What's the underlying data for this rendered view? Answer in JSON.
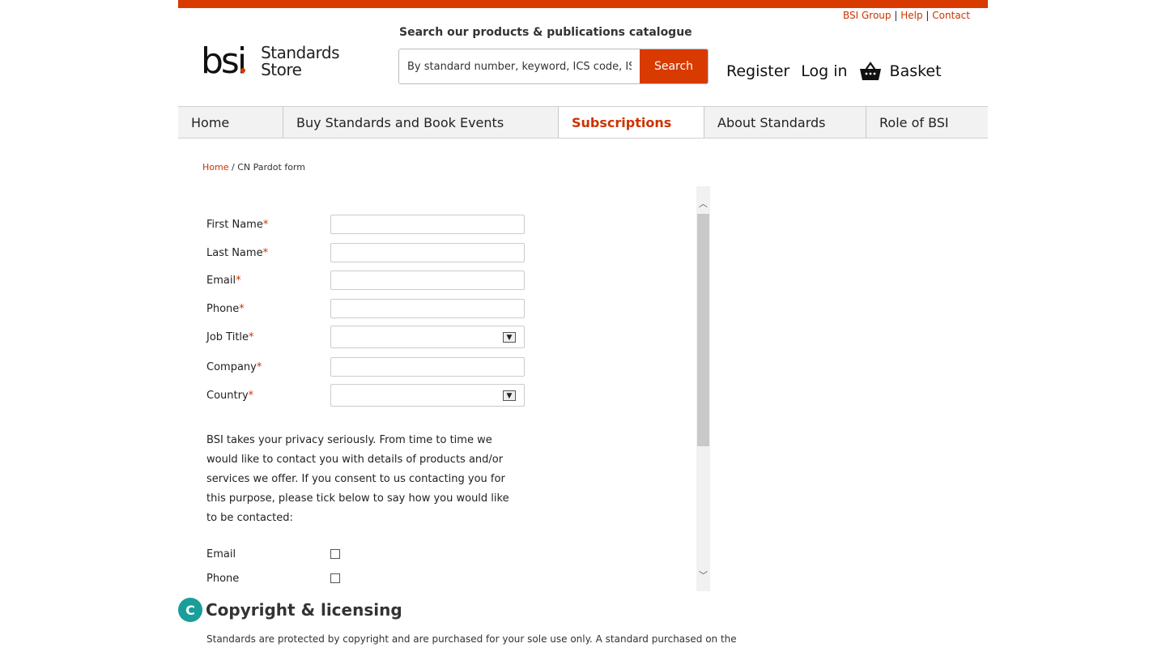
{
  "colors": {
    "brand": "#d83a00",
    "link": "#cc3300",
    "badge": "#1a9e9a"
  },
  "utility_links": {
    "bsi_group": "BSI Group",
    "help": "Help",
    "contact": "Contact",
    "separator": "|"
  },
  "logo": {
    "mark": "bsi",
    "line1": "Standards",
    "line2": "Store"
  },
  "search": {
    "label": "Search our products & publications catalogue",
    "placeholder": "By standard number, keyword, ICS code, ISBN",
    "button": "Search"
  },
  "account": {
    "register": "Register",
    "login": "Log in",
    "basket": "Basket",
    "basket_icon": "basket-icon"
  },
  "nav": {
    "items": [
      {
        "label": "Home"
      },
      {
        "label": "Buy Standards and Book Events"
      },
      {
        "label": "Subscriptions"
      },
      {
        "label": "About Standards"
      },
      {
        "label": "Role of BSI"
      }
    ],
    "active": "Subscriptions"
  },
  "breadcrumb": {
    "home": "Home",
    "sep": " / ",
    "current": "CN Pardot form"
  },
  "form": {
    "fields": [
      {
        "label": "First Name",
        "req": "*"
      },
      {
        "label": "Last Name",
        "req": "*"
      },
      {
        "label": "Email",
        "req": "*"
      },
      {
        "label": "Phone",
        "req": "*"
      },
      {
        "label": "Job Title",
        "req": "*"
      },
      {
        "label": "Company",
        "req": "*"
      },
      {
        "label": "Country",
        "req": "*"
      }
    ],
    "privacy": "BSI takes your privacy seriously. From time to time we would like to contact you with details of products and/or services we offer. If you consent to us contacting you for this purpose, please tick below to say how you would like to be contacted:",
    "contact_options": [
      {
        "label": "Email"
      },
      {
        "label": "Phone"
      }
    ]
  },
  "copyright": {
    "badge": "C",
    "title": "Copyright & licensing",
    "text": "Standards are protected by copyright and are purchased for your sole use only. A standard purchased on the"
  }
}
